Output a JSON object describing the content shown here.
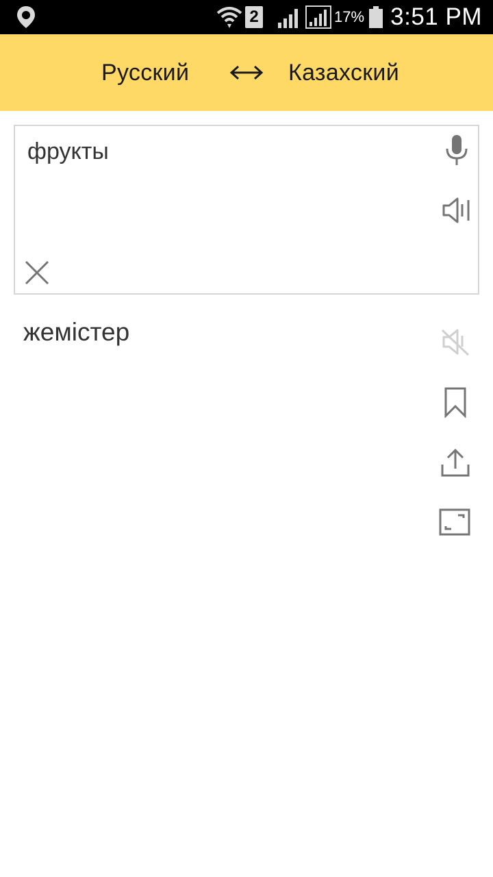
{
  "status_bar": {
    "time": "3:51 PM",
    "battery_percent": "17%",
    "sim_badge": "2",
    "icons": [
      "location-pin-icon",
      "wifi-icon",
      "sim-2-icon",
      "signal-icon",
      "signal-icon-2",
      "battery-icon"
    ]
  },
  "header": {
    "source_language": "Русский",
    "target_language": "Казахский",
    "swap_icon": "swap-arrows-icon",
    "background_color": "#ffd966"
  },
  "input": {
    "text": "фрукты",
    "icons": [
      "microphone-icon",
      "speaker-icon",
      "clear-icon"
    ]
  },
  "output": {
    "text": "жемістер",
    "icons": [
      "speaker-muted-icon",
      "bookmark-icon",
      "share-icon",
      "fullscreen-icon"
    ]
  }
}
